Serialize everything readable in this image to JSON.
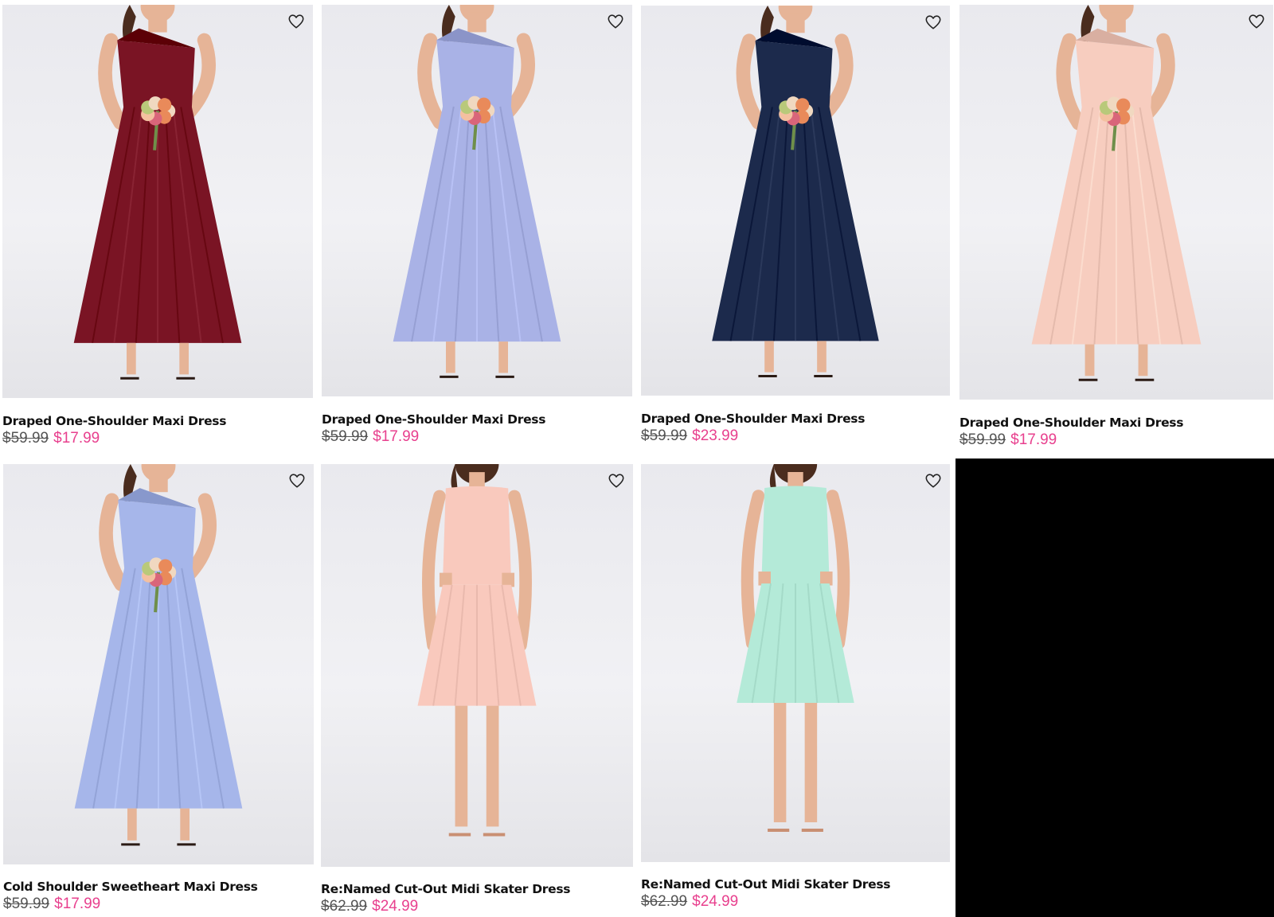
{
  "products": [
    {
      "name": "Draped One-Shoulder Maxi Dress",
      "was_price": "$59.99",
      "sale_price": "$17.99",
      "dress_color": "#7a1424",
      "style": "maxi",
      "favorite_icon": "heart-outline-icon"
    },
    {
      "name": "Draped One-Shoulder Maxi Dress",
      "was_price": "$59.99",
      "sale_price": "$17.99",
      "dress_color": "#a9b2e6",
      "style": "maxi",
      "favorite_icon": "heart-outline-icon"
    },
    {
      "name": "Draped One-Shoulder Maxi Dress",
      "was_price": "$59.99",
      "sale_price": "$23.99",
      "dress_color": "#1c2a4c",
      "style": "maxi",
      "favorite_icon": "heart-outline-icon"
    },
    {
      "name": "Draped One-Shoulder Maxi Dress",
      "was_price": "$59.99",
      "sale_price": "$17.99",
      "dress_color": "#f7cdbf",
      "style": "maxi",
      "favorite_icon": "heart-outline-icon"
    },
    {
      "name": "Cold Shoulder Sweetheart Maxi Dress",
      "was_price": "$59.99",
      "sale_price": "$17.99",
      "dress_color": "#a6b6ea",
      "style": "maxi",
      "favorite_icon": "heart-outline-icon"
    },
    {
      "name": "Re:Named Cut-Out Midi Skater Dress",
      "was_price": "$62.99",
      "sale_price": "$24.99",
      "dress_color": "#f9c9bd",
      "style": "midi",
      "favorite_icon": "heart-outline-icon"
    },
    {
      "name": "Re:Named Cut-Out Midi Skater Dress",
      "was_price": "$62.99",
      "sale_price": "$24.99",
      "dress_color": "#b4ead8",
      "style": "midi",
      "favorite_icon": "heart-outline-icon"
    }
  ],
  "colors": {
    "sale_price": "#e8408e",
    "was_price": "#555555",
    "title": "#111111"
  }
}
